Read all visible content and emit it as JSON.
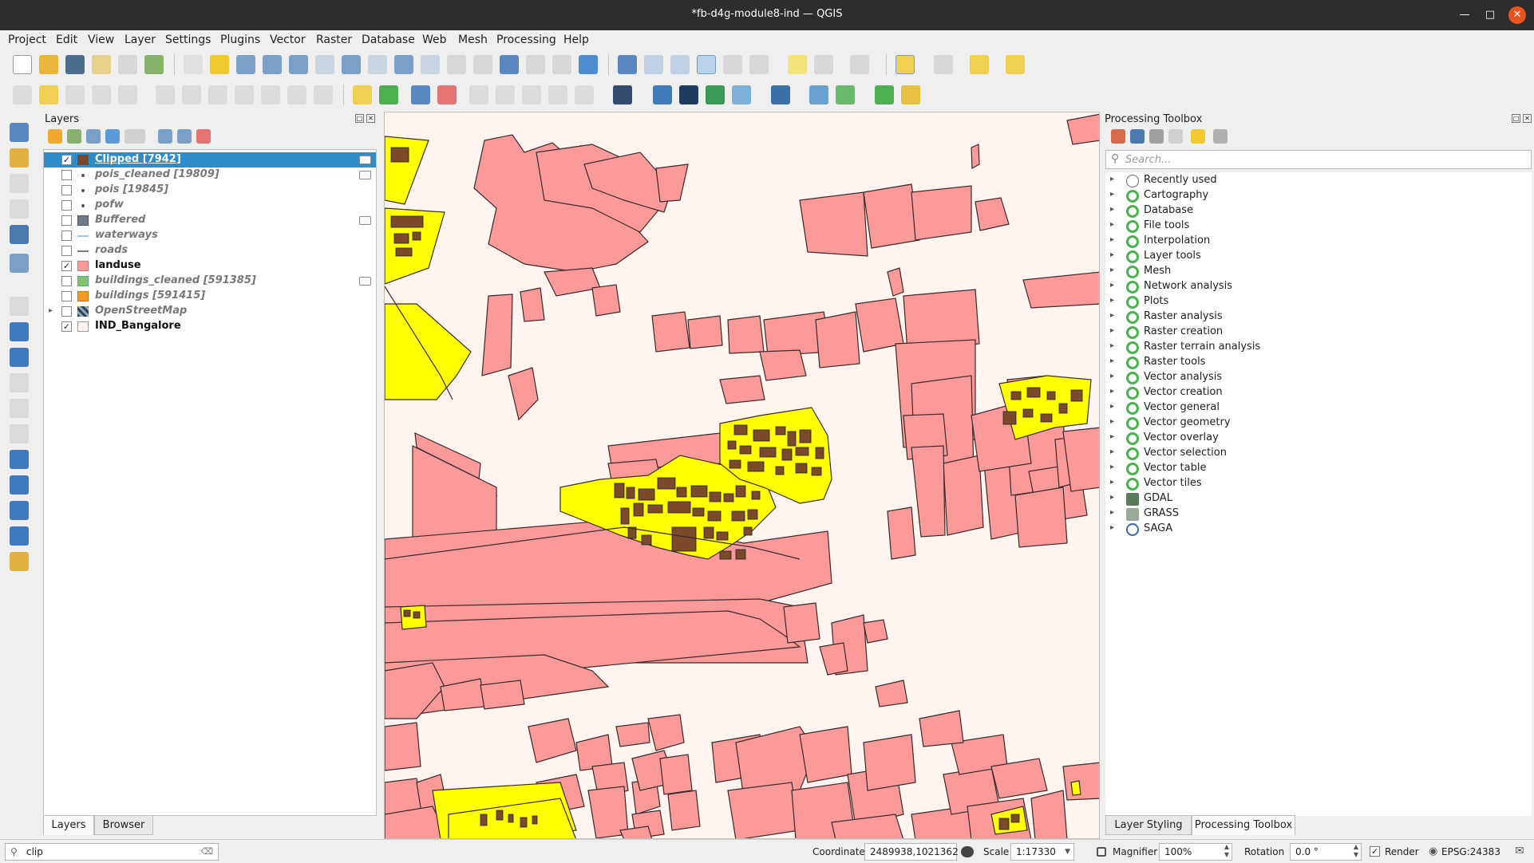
{
  "window": {
    "title": "*fb-d4g-module8-ind — QGIS"
  },
  "menu": [
    "Project",
    "Edit",
    "View",
    "Layer",
    "Settings",
    "Plugins",
    "Vector",
    "Raster",
    "Database",
    "Web",
    "Mesh",
    "Processing",
    "Help"
  ],
  "layers_panel": {
    "title": "Layers",
    "layers": [
      {
        "name": "Clipped [7942]",
        "checked": true,
        "symbol": "fill",
        "color": "#7a4a2a",
        "selected": true,
        "extra_icon": true
      },
      {
        "name": "pois_cleaned [19809]",
        "checked": false,
        "symbol": "point",
        "color": "#555555",
        "extra_icon": true
      },
      {
        "name": "pois [19845]",
        "checked": false,
        "symbol": "point",
        "color": "#555555"
      },
      {
        "name": "pofw",
        "checked": false,
        "symbol": "point",
        "color": "#555555"
      },
      {
        "name": "Buffered",
        "checked": false,
        "symbol": "fill",
        "color": "#6e7a88",
        "extra_icon": true
      },
      {
        "name": "waterways",
        "checked": false,
        "symbol": "line",
        "color": "#a6cee3"
      },
      {
        "name": "roads",
        "checked": false,
        "symbol": "line",
        "color": "#777777"
      },
      {
        "name": "landuse",
        "checked": true,
        "symbol": "fill",
        "color": "#fb9a99"
      },
      {
        "name": "buildings_cleaned [591385]",
        "checked": false,
        "symbol": "fill",
        "color": "#84c26e",
        "extra_icon": true
      },
      {
        "name": "buildings [591415]",
        "checked": false,
        "symbol": "fill",
        "color": "#f59a24"
      },
      {
        "name": "OpenStreetMap",
        "checked": false,
        "symbol": "raster",
        "color": "#334455",
        "expandable": true
      },
      {
        "name": "IND_Bangalore",
        "checked": true,
        "symbol": "fill",
        "color": "#fff4ef"
      }
    ],
    "tabs": [
      "Layers",
      "Browser"
    ]
  },
  "toolbox": {
    "title": "Processing Toolbox",
    "search_placeholder": "Search...",
    "items": [
      {
        "label": "Recently used",
        "icon": "clock-icon"
      },
      {
        "label": "Cartography",
        "icon": "qgis-icon"
      },
      {
        "label": "Database",
        "icon": "qgis-icon"
      },
      {
        "label": "File tools",
        "icon": "qgis-icon"
      },
      {
        "label": "Interpolation",
        "icon": "qgis-icon"
      },
      {
        "label": "Layer tools",
        "icon": "qgis-icon"
      },
      {
        "label": "Mesh",
        "icon": "qgis-icon"
      },
      {
        "label": "Network analysis",
        "icon": "qgis-icon"
      },
      {
        "label": "Plots",
        "icon": "qgis-icon"
      },
      {
        "label": "Raster analysis",
        "icon": "qgis-icon"
      },
      {
        "label": "Raster creation",
        "icon": "qgis-icon"
      },
      {
        "label": "Raster terrain analysis",
        "icon": "qgis-icon"
      },
      {
        "label": "Raster tools",
        "icon": "qgis-icon"
      },
      {
        "label": "Vector analysis",
        "icon": "qgis-icon"
      },
      {
        "label": "Vector creation",
        "icon": "qgis-icon"
      },
      {
        "label": "Vector general",
        "icon": "qgis-icon"
      },
      {
        "label": "Vector geometry",
        "icon": "qgis-icon"
      },
      {
        "label": "Vector overlay",
        "icon": "qgis-icon"
      },
      {
        "label": "Vector selection",
        "icon": "qgis-icon"
      },
      {
        "label": "Vector table",
        "icon": "qgis-icon"
      },
      {
        "label": "Vector tiles",
        "icon": "qgis-icon"
      },
      {
        "label": "GDAL",
        "icon": "gdal-icon"
      },
      {
        "label": "GRASS",
        "icon": "grass-icon"
      },
      {
        "label": "SAGA",
        "icon": "saga-icon"
      }
    ],
    "tabs": [
      "Layer Styling",
      "Processing Toolbox"
    ]
  },
  "status": {
    "locator_value": "clip",
    "coordinate_label": "Coordinate",
    "coordinate_value": "2489938,1021362",
    "scale_label": "Scale",
    "scale_value": "1:17330",
    "magnifier_label": "Magnifier",
    "magnifier_value": "100%",
    "rotation_label": "Rotation",
    "rotation_value": "0.0 °",
    "render_label": "Render",
    "crs": "EPSG:24383"
  },
  "colors": {
    "landuse": "#fb9a99",
    "clipped": "#ffff00",
    "buildings": "#7a4a2a",
    "map_bg": "#fff4ef",
    "selection": "#308cc6"
  }
}
